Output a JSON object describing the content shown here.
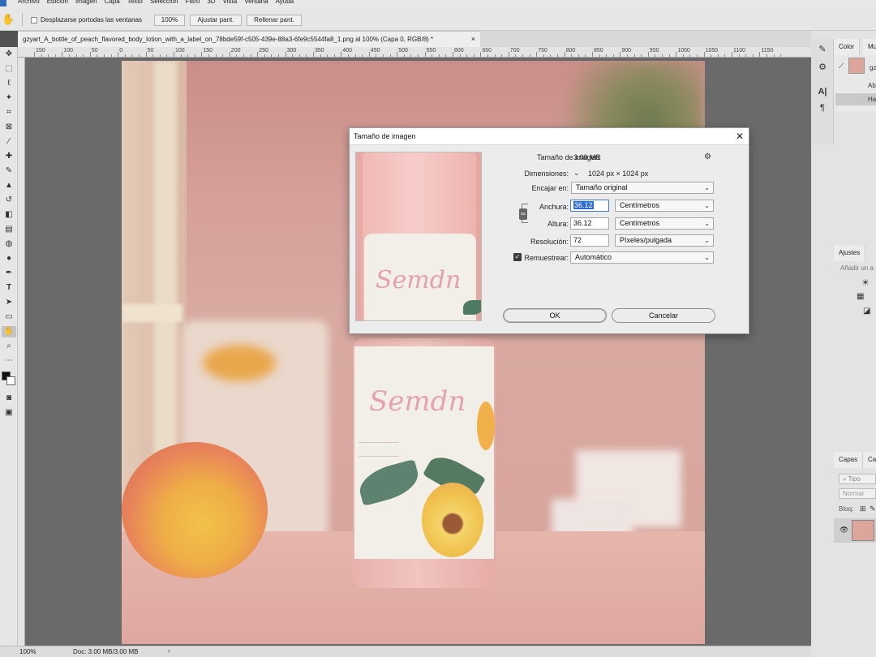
{
  "menu": [
    "Archivo",
    "Edición",
    "Imagen",
    "Capa",
    "Texto",
    "Selección",
    "Filtro",
    "3D",
    "Vista",
    "Ventana",
    "Ayuda"
  ],
  "options": {
    "scroll_all_label": "Desplazarse portodas las ventanas",
    "zoom_button": "100%",
    "fit_button": "Ajustar pant.",
    "fill_button": "Rellenar pant."
  },
  "document": {
    "tab_title": "gzyart_A_bottle_of_peach_flavored_body_lotion_with_a_label_on_78bde59f-c505-439e-88a3-6fe9c5544fa8_1.png al 100% (Capa 0, RGB/8) *",
    "close": "×"
  },
  "ruler": [
    "150",
    "100",
    "50",
    "0",
    "50",
    "100",
    "150",
    "200",
    "250",
    "300",
    "350",
    "400",
    "450",
    "500",
    "550",
    "600",
    "650",
    "700",
    "750",
    "800",
    "850",
    "900",
    "950",
    "1000",
    "1050",
    "1100",
    "1150"
  ],
  "status": {
    "zoom": "100%",
    "doc": "Doc: 3.00 MB/3.00 MB",
    "arrow": "›"
  },
  "photo": {
    "label_text": "Semdn",
    "preview_label_text": "Semdn"
  },
  "right_panel": {
    "tabs": {
      "color": "Color",
      "color2": "Mu",
      "ajustes": "Ajustes",
      "capas": "Capas",
      "canales": "Ca"
    },
    "history_items": [
      "gz",
      "Ab",
      "Ha"
    ],
    "ajustes_hint": "Añadir un a",
    "layers_search": "Tipo",
    "blend_mode": "Normal",
    "lock_label": "Bloq:"
  },
  "dialog": {
    "title": "Tamaño de imagen",
    "close": "✕",
    "size_label": "Tamaño de imagen:",
    "size_value": "3.00 MB",
    "dimensions_label": "Dimensiones:",
    "dimensions_value": "1024 px × 1024 px",
    "fit_label": "Encajar en:",
    "fit_value": "Tamaño original",
    "width_label": "Anchura:",
    "width_value": "36.12",
    "width_unit": "Centímetros",
    "height_label": "Altura:",
    "height_value": "36.12",
    "height_unit": "Centímetros",
    "resolution_label": "Resolución:",
    "resolution_value": "72",
    "resolution_unit": "Píxeles/pulgada",
    "resample_label": "Remuestrear:",
    "resample_checked": true,
    "resample_value": "Automático",
    "ok": "OK",
    "cancel": "Cancelar"
  }
}
